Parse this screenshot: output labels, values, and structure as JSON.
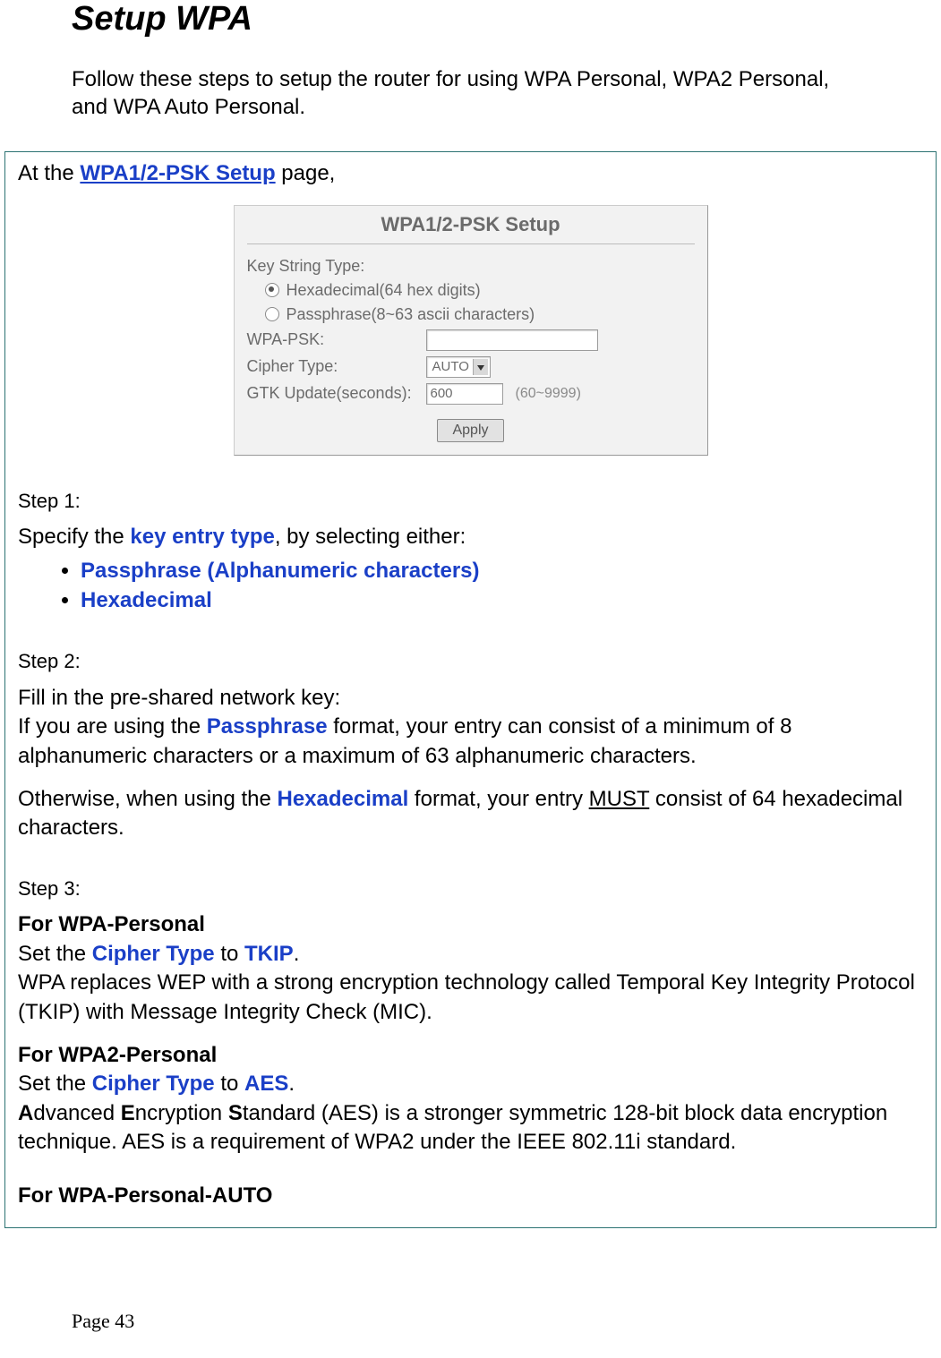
{
  "heading": "Setup WPA",
  "intro": "Follow these steps to setup the router for using WPA Personal, WPA2 Personal, and WPA Auto Personal.",
  "box": {
    "lead_pre": "At the ",
    "lead_link": "WPA1/2-PSK Setup",
    "lead_post": " page,",
    "shot": {
      "title": "WPA1/2-PSK Setup",
      "kst_label": "Key String Type:",
      "radio_hex": "Hexadecimal(64 hex digits)",
      "radio_pass": "Passphrase(8~63 ascii characters)",
      "wpa_psk_label": "WPA-PSK:",
      "cipher_label": "Cipher Type:",
      "cipher_value": "AUTO",
      "gtk_label": "GTK Update(seconds):",
      "gtk_value": "600",
      "gtk_hint": "(60~9999)",
      "apply": "Apply"
    },
    "step1": {
      "label": "Step 1:",
      "line_pre": "Specify the ",
      "line_key": "key entry type",
      "line_post": ", by selecting either:",
      "opt1": "Passphrase (Alphanumeric characters)",
      "opt2": "Hexadecimal"
    },
    "step2": {
      "label": "Step 2:",
      "l1": "Fill in the pre-shared network key:",
      "l2_pre": "If you are using the ",
      "l2_key": "Passphrase",
      "l2_post": " format, your entry can consist of a minimum of 8 alphanumeric characters or a maximum of 63 alphanumeric characters.",
      "l3_pre": "Otherwise, when using the ",
      "l3_key": "Hexadecimal",
      "l3_mid": " format, your entry ",
      "l3_must": "MUST",
      "l3_post": " consist of 64 hexadecimal characters."
    },
    "step3": {
      "label": "Step 3:",
      "wpa_p_h": "For WPA-Personal",
      "wpa_p_set_pre": "Set the ",
      "wpa_p_set_key1": "Cipher Type",
      "wpa_p_set_mid": " to ",
      "wpa_p_set_key2": "TKIP",
      "wpa_p_set_post": ".",
      "wpa_p_desc": "WPA replaces WEP with a strong encryption technology called Temporal Key Integrity Protocol (TKIP) with Message Integrity Check (MIC).",
      "wpa2_h": "For WPA2-Personal",
      "wpa2_set_pre": "Set the ",
      "wpa2_set_key1": "Cipher Type",
      "wpa2_set_mid": " to ",
      "wpa2_set_key2": "AES",
      "wpa2_set_post": ".",
      "wpa2_desc_a": "A",
      "wpa2_desc_b": "dvanced ",
      "wpa2_desc_c": "E",
      "wpa2_desc_d": "ncryption ",
      "wpa2_desc_e": "S",
      "wpa2_desc_f": "tandard (AES) is a stronger symmetric 128-bit block data encryption technique. AES is a requirement of WPA2 under the IEEE 802.11i standard.",
      "wpa_auto_h": "For WPA-Personal-AUTO"
    }
  },
  "footer": "Page 43"
}
